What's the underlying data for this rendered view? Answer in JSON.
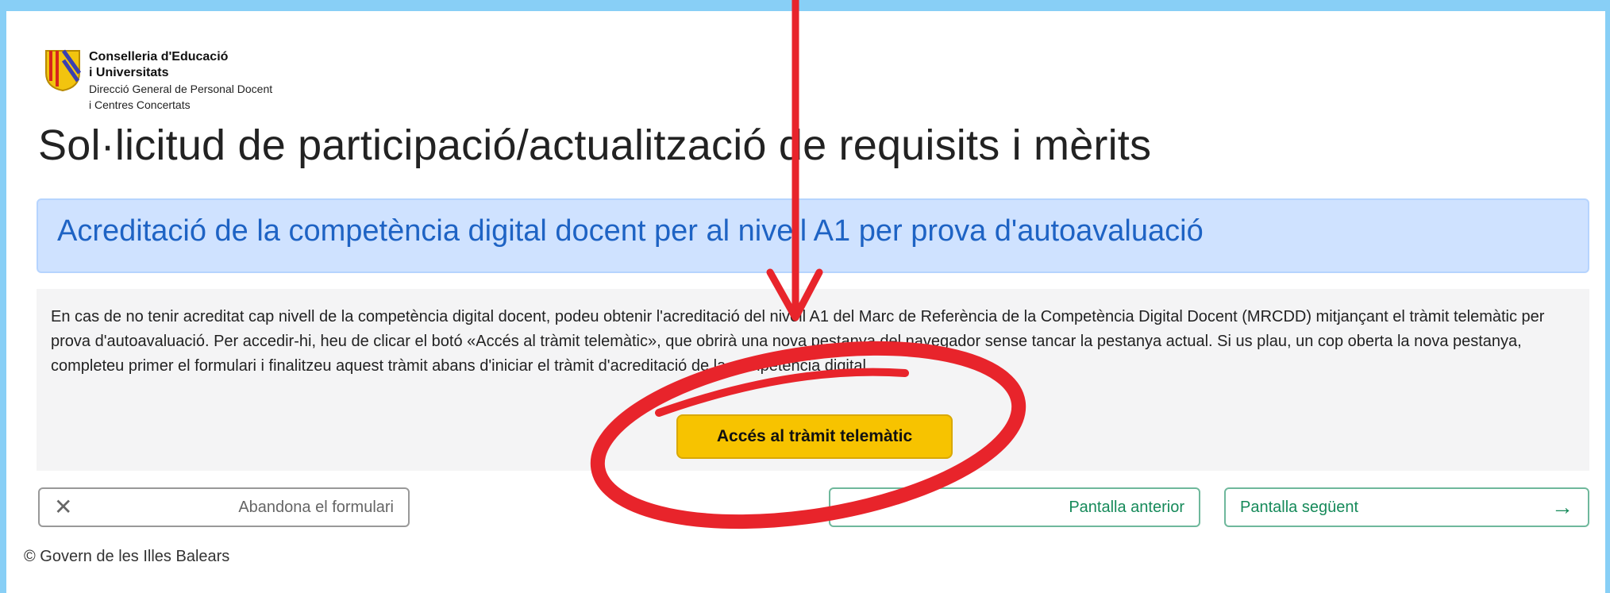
{
  "header": {
    "org_line1": "Conselleria d'Educació",
    "org_line2": "i Universitats",
    "org_line3": "Direcció General de Personal Docent",
    "org_line4": "i Centres Concertats"
  },
  "page_title": "Sol·licitud de participació/actualització de requisits i mèrits",
  "section": {
    "heading": "Acreditació de la competència digital docent per al nivell A1 per prova d'autoavaluació",
    "description": "En cas de no tenir acreditat cap nivell de la competència digital docent, podeu obtenir l'acreditació del nivell A1 del Marc de Referència de la Competència Digital Docent (MRCDD) mitjançant el tràmit telemàtic per prova d'autoavaluació. Per accedir-hi, heu de clicar el botó «Accés al tràmit telemàtic», que obrirà una nova pestanya del navegador sense tancar la pestanya actual. Si us plau, un cop oberta la nova pestanya, completeu primer el formulari i finalitzeu aquest tràmit abans d'iniciar el tràmit d'acreditació de la competència digital.",
    "cta_label": "Accés al tràmit telemàtic"
  },
  "navigation": {
    "abandon_label": "Abandona el formulari",
    "previous_label": "Pantalla anterior",
    "next_label": "Pantalla següent"
  },
  "footer": {
    "copyright": "© Govern de les Illes Balears"
  },
  "icons": {
    "logo": "balearic-shield-icon",
    "abandon": "close-icon",
    "previous": "arrow-left-icon",
    "next": "arrow-right-icon"
  },
  "colors": {
    "outer_frame": "#88cff6",
    "panel_bg": "#cfe2ff",
    "heading_blue": "#1e63c4",
    "cta_yellow": "#f7c300",
    "nav_green": "#168a5a",
    "annotation_red": "#e8242b"
  }
}
